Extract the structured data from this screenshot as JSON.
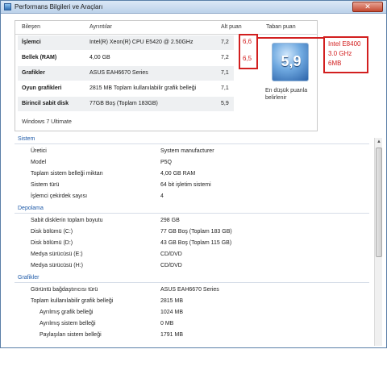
{
  "window": {
    "title": "Performans Bilgileri ve Araçları",
    "close_label": "✕"
  },
  "score_table": {
    "headers": {
      "component": "Bileşen",
      "details": "Ayrıntılar",
      "subscore": "Alt puan",
      "base_score": "Taban puan"
    },
    "rows": [
      {
        "category": "İşlemci",
        "detail": "Intel(R) Xeon(R) CPU E5420 @ 2.50GHz",
        "score": "7,2"
      },
      {
        "category": "Bellek (RAM)",
        "detail": "4,00 GB",
        "score": "7,2"
      },
      {
        "category": "Grafikler",
        "detail": "ASUS EAH6670 Series",
        "score": "7,1"
      },
      {
        "category": "Oyun grafikleri",
        "detail": "2815 MB Toplam kullanılabilir grafik belleği",
        "score": "7,1"
      },
      {
        "category": "Birincil sabit disk",
        "detail": "77GB Boş (Toplam 183GB)",
        "score": "5,9"
      }
    ],
    "base_score": "5,9",
    "base_caption": "En düşük puanla belirlenir",
    "os": "Windows 7 Ultimate"
  },
  "annotations": {
    "cpu_score_1": "6,6",
    "cpu_score_2": "6,5",
    "spec_lines": [
      "Intel E8400",
      "3.0 GHz",
      "6MB"
    ]
  },
  "details": {
    "sistem": {
      "title": "Sistem",
      "items": [
        {
          "label": "Üretici",
          "value": "System manufacturer"
        },
        {
          "label": "Model",
          "value": "P5Q"
        },
        {
          "label": "Toplam sistem belleği miktarı",
          "value": "4,00 GB RAM"
        },
        {
          "label": "Sistem türü",
          "value": "64 bit işletim sistemi"
        },
        {
          "label": "İşlemci çekirdek sayısı",
          "value": "4"
        }
      ]
    },
    "depolama": {
      "title": "Depolama",
      "items": [
        {
          "label": "Sabit disklerin toplam boyutu",
          "value": "298 GB"
        },
        {
          "label": "Disk bölümü (C:)",
          "value": "77 GB Boş (Toplam 183 GB)"
        },
        {
          "label": "Disk bölümü (D:)",
          "value": "43 GB Boş (Toplam 115 GB)"
        },
        {
          "label": "Medya sürücüsü (E:)",
          "value": "CD/DVD"
        },
        {
          "label": "Medya sürücüsü (H:)",
          "value": "CD/DVD"
        }
      ]
    },
    "grafikler": {
      "title": "Grafikler",
      "items": [
        {
          "label": "Görüntü bağdaştırıcısı türü",
          "value": "ASUS EAH6670 Series"
        },
        {
          "label": "Toplam kullanılabilir grafik belleği",
          "value": "2815 MB"
        },
        {
          "label": "Ayrılmış grafik belleği",
          "value": "1024 MB"
        },
        {
          "label": "Ayrılmış sistem belleği",
          "value": "0 MB"
        },
        {
          "label": "Paylaşılan sistem belleği",
          "value": "1791 MB"
        }
      ]
    }
  },
  "colors": {
    "annotation": "#d21f1f",
    "section_heading": "#1e5aa8",
    "badge": "#2c63a9"
  },
  "icons": {
    "app": "performance-icon",
    "close": "close-icon",
    "scroll_up": "scroll-up-arrow-icon"
  }
}
